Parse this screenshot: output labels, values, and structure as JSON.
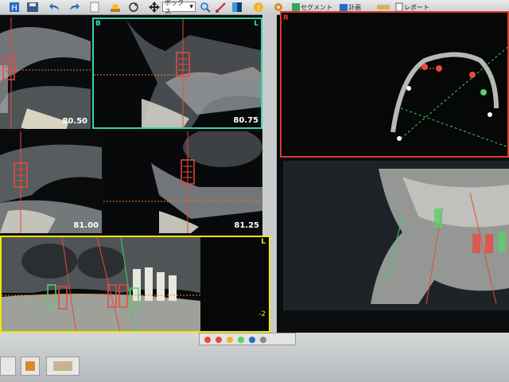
{
  "toolbar": {
    "view_mode_select": "ボックス",
    "label_segment": "セグメント",
    "label_plan": "計画",
    "label_report": "レポート"
  },
  "views": {
    "top_left": {
      "slice": "80.50"
    },
    "top_mid": {
      "corner_left": "B",
      "corner_right": "L",
      "slice": "80.75"
    },
    "mid_left": {
      "slice": "81.00"
    },
    "mid_mid": {
      "slice": "81.25"
    },
    "axial": {
      "corner_left": "R"
    },
    "bottom": {
      "corner_right": "L",
      "scale": "-2"
    }
  },
  "colors": {
    "active_border": "#33d6a8",
    "selected_border": "#f2e600",
    "axial_border": "#d83a2e",
    "orange_axis": "#ff7a2a",
    "implant_red": "#e84a3c",
    "implant_green": "#57d16c"
  }
}
